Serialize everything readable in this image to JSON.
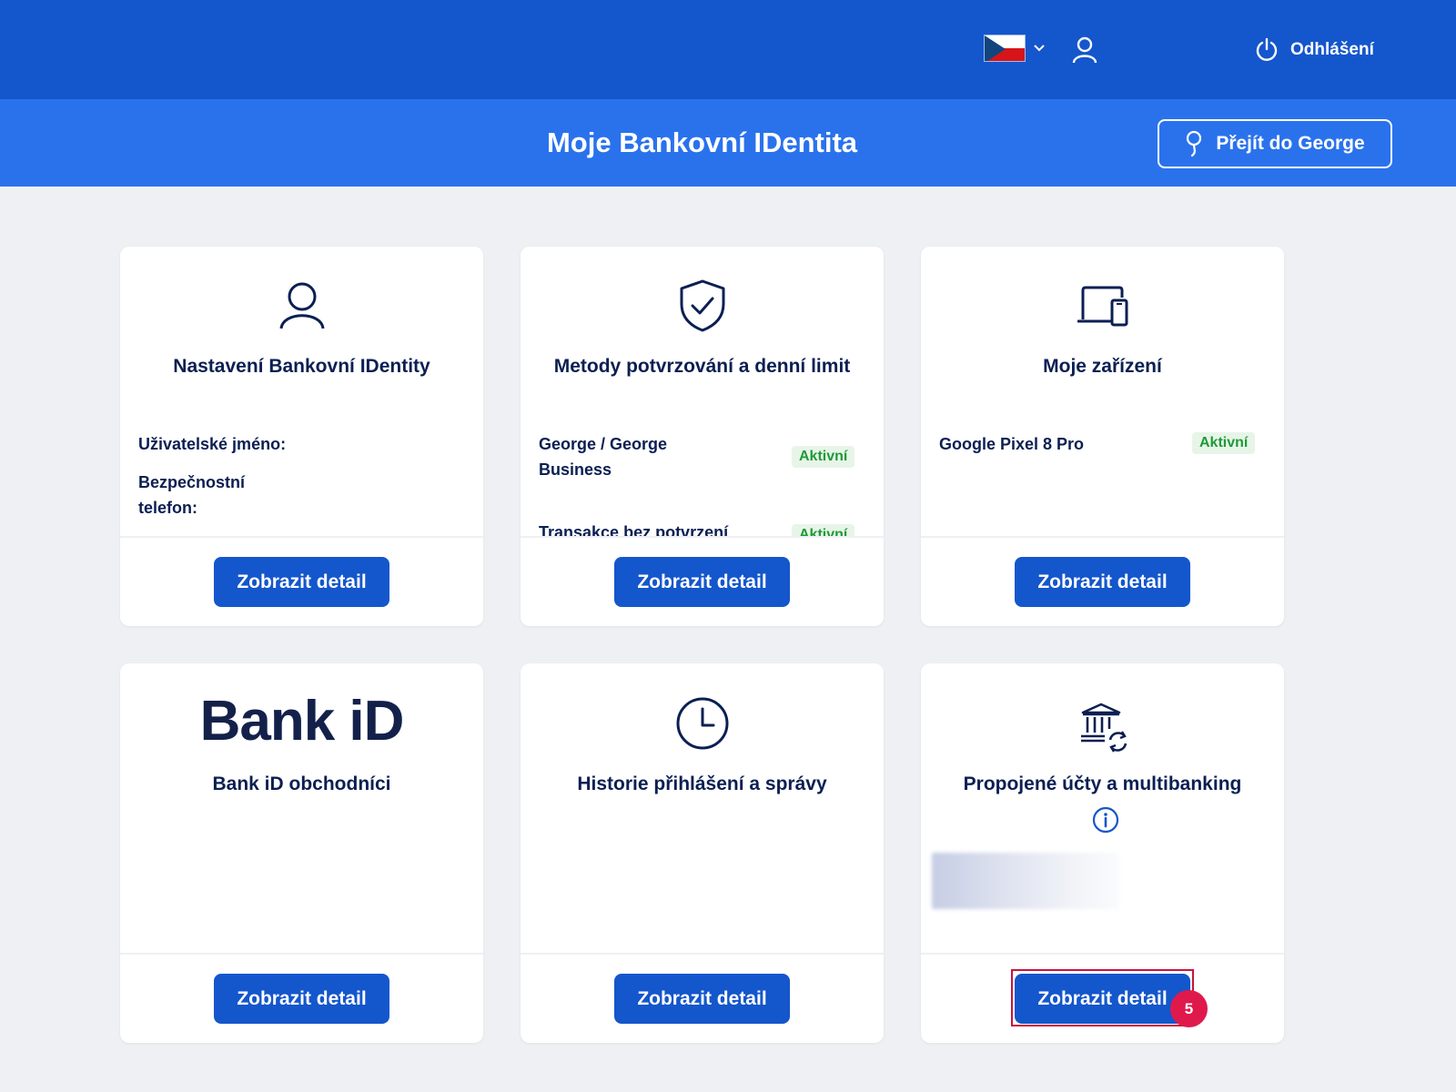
{
  "header": {
    "language_flag": "cz-flag-icon",
    "logout_label": "Odhlášení"
  },
  "titlebar": {
    "title": "Moje Bankovní IDentita",
    "george_button": "Přejít do George"
  },
  "cards": [
    {
      "icon": "user-icon",
      "title": "Nastavení Bankovní IDentity",
      "rows": [
        "Uživatelské jméno:",
        "Bezpečnostní telefon:"
      ],
      "button": "Zobrazit detail"
    },
    {
      "icon": "shield-check-icon",
      "title": "Metody potvrzování a denní limit",
      "rows": [
        {
          "label": "George / George Business",
          "status": "Aktivní"
        },
        {
          "label": "Transakce bez potvrzení",
          "status": "Aktivní"
        }
      ],
      "button": "Zobrazit detail"
    },
    {
      "icon": "devices-icon",
      "title": "Moje zařízení",
      "rows": [
        {
          "label": "Google Pixel 8 Pro",
          "status": "Aktivní"
        }
      ],
      "button": "Zobrazit detail"
    },
    {
      "logo": "Bank iD",
      "title": "Bank iD obchodníci",
      "button": "Zobrazit detail"
    },
    {
      "icon": "clock-icon",
      "title": "Historie přihlášení a správy",
      "button": "Zobrazit detail"
    },
    {
      "icon": "bank-sync-icon",
      "title": "Propojené účty a multibanking",
      "info_icon": "info-icon",
      "button": "Zobrazit detail"
    }
  ],
  "annotation": {
    "step": "5"
  },
  "colors": {
    "header": "#1456cc",
    "titlebar": "#2a72ec",
    "button": "#1456cc",
    "background": "#eef0f4",
    "active_badge": "#1f9a36",
    "highlight": "#c8143c"
  }
}
